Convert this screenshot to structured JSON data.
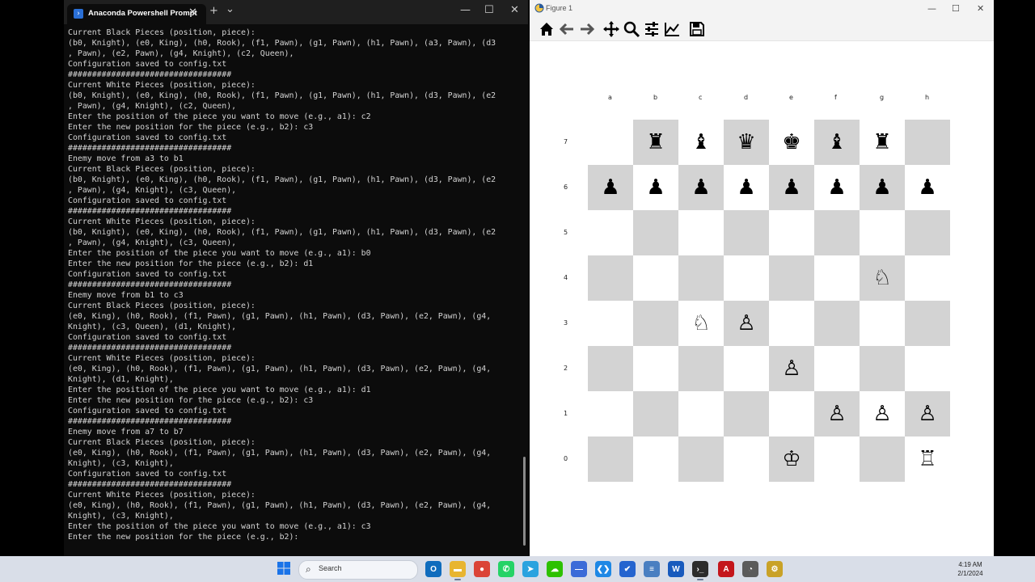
{
  "terminal": {
    "tab_title": "Anaconda Powershell Prompt",
    "new_tab": "+",
    "dropdown": "⌄",
    "lines": [
      "Current Black Pieces (position, piece):",
      "(b0, Knight), (e0, King), (h0, Rook), (f1, Pawn), (g1, Pawn), (h1, Pawn), (a3, Pawn), (d3",
      ", Pawn), (e2, Pawn), (g4, Knight), (c2, Queen),",
      "Configuration saved to config.txt",
      "##################################",
      "Current White Pieces (position, piece):",
      "(b0, Knight), (e0, King), (h0, Rook), (f1, Pawn), (g1, Pawn), (h1, Pawn), (d3, Pawn), (e2",
      ", Pawn), (g4, Knight), (c2, Queen),",
      "Enter the position of the piece you want to move (e.g., a1): c2",
      "Enter the new position for the piece (e.g., b2): c3",
      "Configuration saved to config.txt",
      "##################################",
      "Enemy move from a3 to b1",
      "Current Black Pieces (position, piece):",
      "(b0, Knight), (e0, King), (h0, Rook), (f1, Pawn), (g1, Pawn), (h1, Pawn), (d3, Pawn), (e2",
      ", Pawn), (g4, Knight), (c3, Queen),",
      "Configuration saved to config.txt",
      "##################################",
      "Current White Pieces (position, piece):",
      "(b0, Knight), (e0, King), (h0, Rook), (f1, Pawn), (g1, Pawn), (h1, Pawn), (d3, Pawn), (e2",
      ", Pawn), (g4, Knight), (c3, Queen),",
      "Enter the position of the piece you want to move (e.g., a1): b0",
      "Enter the new position for the piece (e.g., b2): d1",
      "Configuration saved to config.txt",
      "##################################",
      "Enemy move from b1 to c3",
      "Current Black Pieces (position, piece):",
      "(e0, King), (h0, Rook), (f1, Pawn), (g1, Pawn), (h1, Pawn), (d3, Pawn), (e2, Pawn), (g4,",
      "Knight), (c3, Queen), (d1, Knight),",
      "Configuration saved to config.txt",
      "##################################",
      "Current White Pieces (position, piece):",
      "(e0, King), (h0, Rook), (f1, Pawn), (g1, Pawn), (h1, Pawn), (d3, Pawn), (e2, Pawn), (g4,",
      "Knight), (d1, Knight),",
      "Enter the position of the piece you want to move (e.g., a1): d1",
      "Enter the new position for the piece (e.g., b2): c3",
      "Configuration saved to config.txt",
      "##################################",
      "Enemy move from a7 to b7",
      "Current Black Pieces (position, piece):",
      "(e0, King), (h0, Rook), (f1, Pawn), (g1, Pawn), (h1, Pawn), (d3, Pawn), (e2, Pawn), (g4,",
      "Knight), (c3, Knight),",
      "Configuration saved to config.txt",
      "##################################",
      "Current White Pieces (position, piece):",
      "(e0, King), (h0, Rook), (f1, Pawn), (g1, Pawn), (h1, Pawn), (d3, Pawn), (e2, Pawn), (g4,",
      "Knight), (c3, Knight),",
      "Enter the position of the piece you want to move (e.g., a1): c3",
      "Enter the new position for the piece (e.g., b2): "
    ]
  },
  "figure": {
    "title": "Figure 1",
    "toolbar": [
      "home-icon",
      "back-icon",
      "forward-icon",
      "pan-icon",
      "zoom-icon",
      "configure-subplots-icon",
      "edit-axis-icon",
      "save-icon"
    ],
    "files": [
      "a",
      "b",
      "c",
      "d",
      "e",
      "f",
      "g",
      "h"
    ],
    "ranks": [
      "7",
      "6",
      "5",
      "4",
      "3",
      "2",
      "1",
      "0"
    ],
    "pieces": [
      {
        "square": "b7",
        "symbol": "♜"
      },
      {
        "square": "c7",
        "symbol": "♝"
      },
      {
        "square": "d7",
        "symbol": "♛"
      },
      {
        "square": "e7",
        "symbol": "♚"
      },
      {
        "square": "f7",
        "symbol": "♝"
      },
      {
        "square": "g7",
        "symbol": "♜"
      },
      {
        "square": "a6",
        "symbol": "♟"
      },
      {
        "square": "b6",
        "symbol": "♟"
      },
      {
        "square": "c6",
        "symbol": "♟"
      },
      {
        "square": "d6",
        "symbol": "♟"
      },
      {
        "square": "e6",
        "symbol": "♟"
      },
      {
        "square": "f6",
        "symbol": "♟"
      },
      {
        "square": "g6",
        "symbol": "♟"
      },
      {
        "square": "h6",
        "symbol": "♟"
      },
      {
        "square": "g4",
        "symbol": "♘"
      },
      {
        "square": "c3",
        "symbol": "♘"
      },
      {
        "square": "d3",
        "symbol": "♙"
      },
      {
        "square": "e2",
        "symbol": "♙"
      },
      {
        "square": "f1",
        "symbol": "♙"
      },
      {
        "square": "g1",
        "symbol": "♙"
      },
      {
        "square": "h1",
        "symbol": "♙"
      },
      {
        "square": "e0",
        "symbol": "♔"
      },
      {
        "square": "h0",
        "symbol": "♖"
      }
    ]
  },
  "taskbar": {
    "search_placeholder": "Search",
    "time": "4:19 AM",
    "date": "2/1/2024",
    "apps": [
      {
        "name": "outlook",
        "color": "#0f6cbd",
        "glyph": "O"
      },
      {
        "name": "file-explorer",
        "color": "#e8b530",
        "glyph": "▬"
      },
      {
        "name": "chrome",
        "color": "#db4437",
        "glyph": "●"
      },
      {
        "name": "whatsapp",
        "color": "#25d366",
        "glyph": "✆"
      },
      {
        "name": "telegram",
        "color": "#2aa3df",
        "glyph": "➤"
      },
      {
        "name": "wechat",
        "color": "#2dc100",
        "glyph": "☁"
      },
      {
        "name": "app-blue",
        "color": "#3b6bd8",
        "glyph": "—"
      },
      {
        "name": "vscode",
        "color": "#1e88e5",
        "glyph": "❮❯"
      },
      {
        "name": "todo",
        "color": "#2564cf",
        "glyph": "✔"
      },
      {
        "name": "notepad",
        "color": "#4a7fc1",
        "glyph": "≡"
      },
      {
        "name": "word",
        "color": "#185abd",
        "glyph": "W"
      },
      {
        "name": "terminal",
        "color": "#2c2c2c",
        "glyph": "›_"
      },
      {
        "name": "acrobat",
        "color": "#c4161c",
        "glyph": "A"
      },
      {
        "name": "app-gray",
        "color": "#5b5b5b",
        "glyph": "◔"
      },
      {
        "name": "app-yellow",
        "color": "#c9a227",
        "glyph": "⚙"
      }
    ]
  }
}
